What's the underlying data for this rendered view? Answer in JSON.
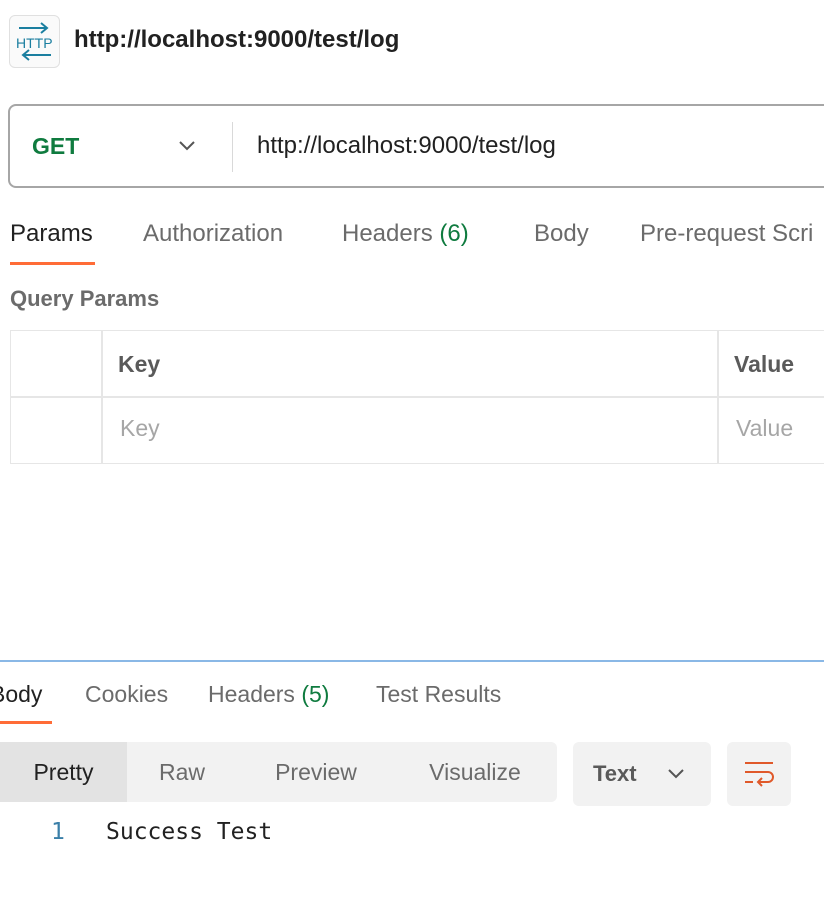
{
  "header": {
    "icon": "http-icon",
    "icon_text": "HTTP",
    "title": "http://localhost:9000/test/log"
  },
  "request": {
    "method": "GET",
    "url": "http://localhost:9000/test/log",
    "method_color": "#0f7b3f"
  },
  "request_tabs": [
    {
      "label": "Params",
      "active": true
    },
    {
      "label": "Authorization"
    },
    {
      "label": "Headers",
      "count": "(6)"
    },
    {
      "label": "Body"
    },
    {
      "label": "Pre-request Scri"
    }
  ],
  "query_params": {
    "title": "Query Params",
    "columns": [
      "Key",
      "Value"
    ],
    "placeholders": {
      "key": "Key",
      "value": "Value"
    }
  },
  "response_tabs": [
    {
      "label": "Body",
      "active": true
    },
    {
      "label": "Cookies"
    },
    {
      "label": "Headers",
      "count": "(5)"
    },
    {
      "label": "Test Results"
    }
  ],
  "format": {
    "options": [
      "Pretty",
      "Raw",
      "Preview",
      "Visualize"
    ],
    "selected": "Pretty",
    "type_select": "Text",
    "wrap_icon": "wrap-lines-icon"
  },
  "response_body": {
    "lines": [
      {
        "number": "1",
        "text": "Success Test"
      }
    ]
  },
  "colors": {
    "accent": "#ff6c37",
    "success": "#0f7b3f",
    "divider": "#8ab8e6"
  }
}
